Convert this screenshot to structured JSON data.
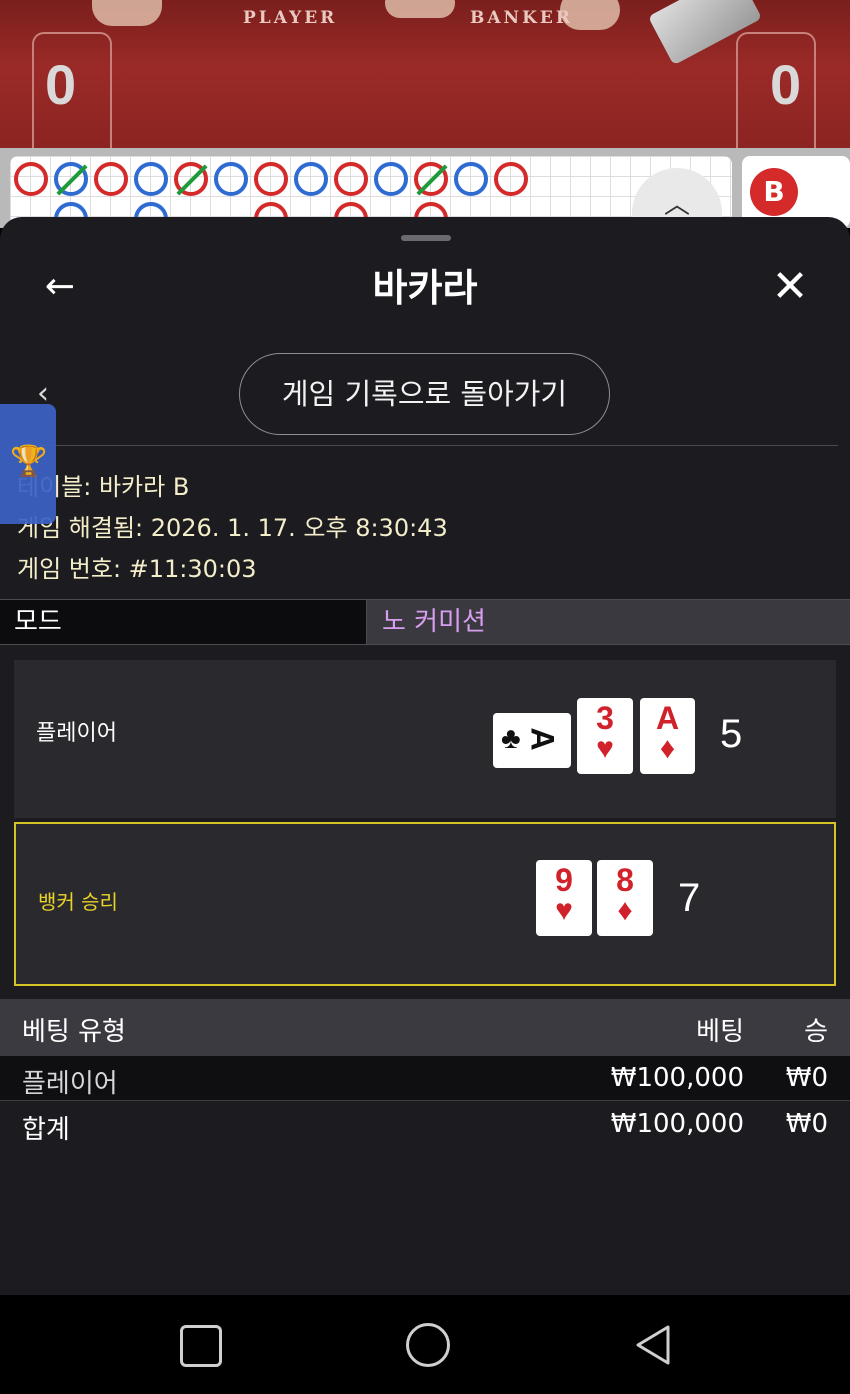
{
  "background": {
    "player_label": "PLAYER",
    "banker_label": "BANKER",
    "player_score": "0",
    "banker_score": "0",
    "road_side_chip": "B",
    "collapse_icon": "chevron-up-icon"
  },
  "header": {
    "back_icon": "←",
    "title": "바카라",
    "close_icon": "✕"
  },
  "return_button": "게임 기록으로 돌아가기",
  "prev_icon": "‹",
  "info": {
    "table_line": "테이블: 바카라 B",
    "resolved_line": "게임 해결됨: 2026. 1. 17. 오후 8:30:43",
    "number_line": "게임 번호: #11:30:03"
  },
  "mode": {
    "label": "모드",
    "value": "노 커미션"
  },
  "hands": {
    "player": {
      "name": "플레이어",
      "cards": [
        {
          "rank": "A",
          "suit": "♣",
          "orientation": "sideways",
          "color": "black"
        },
        {
          "rank": "3",
          "suit": "♥",
          "orientation": "upright",
          "color": "red"
        },
        {
          "rank": "A",
          "suit": "♦",
          "orientation": "upright",
          "color": "red"
        }
      ],
      "total": "5"
    },
    "banker": {
      "name": "뱅커 승리",
      "cards": [
        {
          "rank": "9",
          "suit": "♥",
          "orientation": "upright",
          "color": "red"
        },
        {
          "rank": "8",
          "suit": "♦",
          "orientation": "upright",
          "color": "red"
        }
      ],
      "total": "7"
    }
  },
  "bets": {
    "headers": {
      "type": "베팅 유형",
      "bet": "베팅",
      "win": "승"
    },
    "rows": [
      {
        "type": "플레이어",
        "bet": "₩100,000",
        "win": "₩0"
      }
    ],
    "total": {
      "type": "합계",
      "bet": "₩100,000",
      "win": "₩0"
    }
  },
  "colors": {
    "sheet_bg": "#1c1b20",
    "winner_border": "#d4c425",
    "mode_value": "#d89df0",
    "info_text": "#f3edc9"
  }
}
